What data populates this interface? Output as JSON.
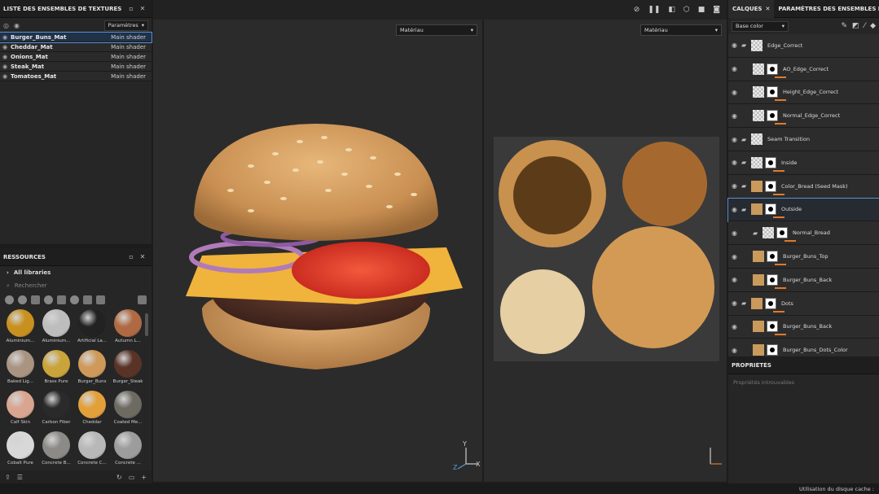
{
  "texture_sets": {
    "title": "LISTE DES ENSEMBLES DE TEXTURES",
    "settings_label": "Paramètres",
    "rows": [
      {
        "name": "Burger_Buns_Mat",
        "shader": "Main shader"
      },
      {
        "name": "Cheddar_Mat",
        "shader": "Main shader"
      },
      {
        "name": "Onions_Mat",
        "shader": "Main shader"
      },
      {
        "name": "Steak_Mat",
        "shader": "Main shader"
      },
      {
        "name": "Tomatoes_Mat",
        "shader": "Main shader"
      }
    ]
  },
  "resources": {
    "title": "RESSOURCES",
    "library": "All libraries",
    "search_placeholder": "Rechercher",
    "items": [
      {
        "label": "Aluminium...",
        "color": "#c8901e"
      },
      {
        "label": "Aluminium...",
        "color": "#bdbdbd"
      },
      {
        "label": "Artificial La...",
        "color": "#222222"
      },
      {
        "label": "Autumn L...",
        "color": "#b06a43"
      },
      {
        "label": "Baked Lig...",
        "color": "#a99482"
      },
      {
        "label": "Brass Pure",
        "color": "#c9a43a"
      },
      {
        "label": "Burger_Buns",
        "color": "#cf995a"
      },
      {
        "label": "Burger_Steak",
        "color": "#5a3327"
      },
      {
        "label": "Calf Skin",
        "color": "#d9a590"
      },
      {
        "label": "Carbon Fiber",
        "color": "#2a2a2a"
      },
      {
        "label": "Cheddar",
        "color": "#e3a03a"
      },
      {
        "label": "Coated Me...",
        "color": "#6d6a62"
      },
      {
        "label": "Cobalt Pure",
        "color": "#d8d8d8"
      },
      {
        "label": "Concrete B...",
        "color": "#8c8a86"
      },
      {
        "label": "Concrete C...",
        "color": "#b8b8b8"
      },
      {
        "label": "Concrete ...",
        "color": "#9c9c9c"
      }
    ]
  },
  "viewport": {
    "left_dropdown": "Matériau",
    "right_dropdown": "Matériau"
  },
  "layers": {
    "tab_layers": "CALQUES",
    "tab_params": "PARAMÈTRES DES ENSEMBLES DE TEXTURES",
    "channel": "Base color",
    "items": [
      {
        "name": "Edge_Correct",
        "kind": "folder",
        "thumbs": [
          "chk"
        ],
        "bars": 0
      },
      {
        "name": "AO_Edge_Correct",
        "kind": "child",
        "thumbs": [
          "chk",
          "mask"
        ],
        "bars": 1
      },
      {
        "name": "Height_Edge_Correct",
        "kind": "child",
        "thumbs": [
          "chk",
          "mask"
        ],
        "bars": 1
      },
      {
        "name": "Normal_Edge_Correct",
        "kind": "child",
        "thumbs": [
          "chk",
          "mask"
        ],
        "bars": 1
      },
      {
        "name": "Seam Transition",
        "kind": "folder",
        "thumbs": [
          "chk"
        ],
        "bars": 0
      },
      {
        "name": "Inside",
        "kind": "folder",
        "thumbs": [
          "chk",
          "mask"
        ],
        "bars": 1
      },
      {
        "name": "Color_Bread (Seed Mask)",
        "kind": "folder",
        "thumbs": [
          "tan",
          "mask"
        ],
        "bars": 1
      },
      {
        "name": "Outside",
        "kind": "folder",
        "thumbs": [
          "tan",
          "mask"
        ],
        "bars": 1,
        "selected": true
      },
      {
        "name": "Normal_Bread",
        "kind": "subfolder",
        "thumbs": [
          "chk",
          "mask"
        ],
        "bars": 2
      },
      {
        "name": "Burger_Buns_Top",
        "kind": "child",
        "thumbs": [
          "tan",
          "mask"
        ],
        "bars": 1
      },
      {
        "name": "Burger_Buns_Back",
        "kind": "child",
        "thumbs": [
          "tan",
          "mask"
        ],
        "bars": 1
      },
      {
        "name": "Dots",
        "kind": "folder",
        "thumbs": [
          "tan",
          "mask"
        ],
        "bars": 1
      },
      {
        "name": "Burger_Buns_Back",
        "kind": "child",
        "thumbs": [
          "tan",
          "mask"
        ],
        "bars": 1
      },
      {
        "name": "Burger_Buns_Dots_Color",
        "kind": "child",
        "thumbs": [
          "tan",
          "mask"
        ],
        "bars": 1
      }
    ]
  },
  "properties": {
    "title": "PROPRIÉTÉS",
    "empty": "Propriétés introuvables"
  },
  "status": {
    "text": "Utilisation du disque cache :"
  }
}
